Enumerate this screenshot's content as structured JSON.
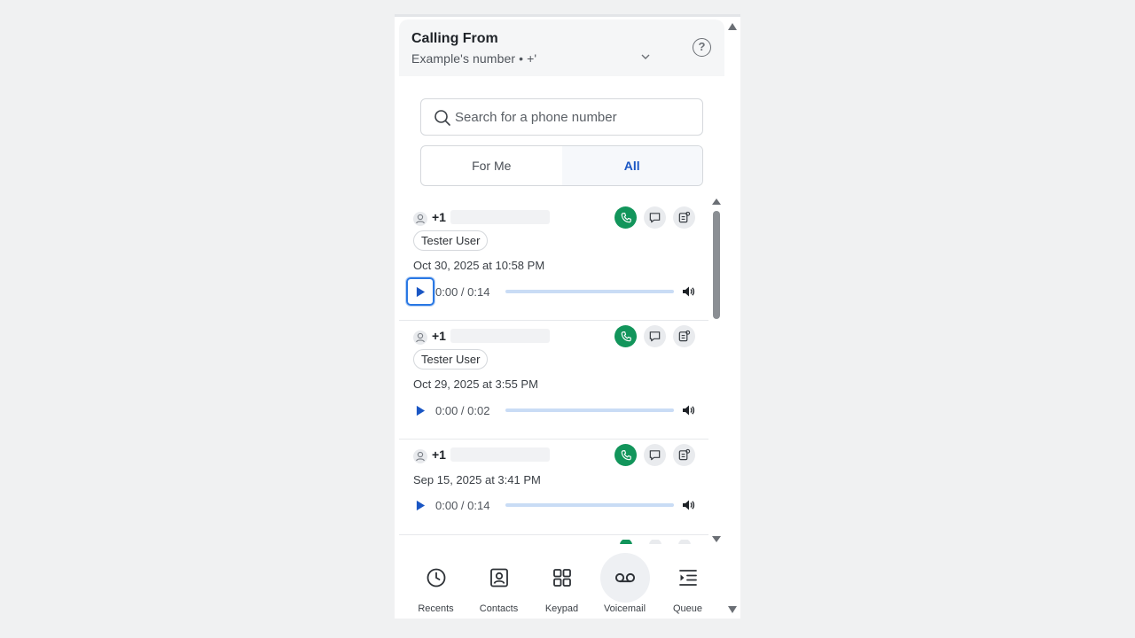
{
  "header": {
    "title": "Calling From",
    "subtitle": "Example's number • +'",
    "help_glyph": "?"
  },
  "search": {
    "placeholder": "Search for a phone number",
    "value": ""
  },
  "filter": {
    "options": [
      "For Me",
      "All"
    ],
    "selected": "All"
  },
  "voicemails": [
    {
      "phone": "+1",
      "tag": "Tester User",
      "date": "Oct 30, 2025 at 10:58 PM",
      "time": "0:00 / 0:14"
    },
    {
      "phone": "+1",
      "tag": "Tester User",
      "date": "Oct 29, 2025 at 3:55 PM",
      "time": "0:00 / 0:02"
    },
    {
      "phone": "+1",
      "tag": "",
      "date": "Sep 15, 2025 at 3:41 PM",
      "time": "0:00 / 0:14"
    }
  ],
  "nav": {
    "items": [
      {
        "label": "Recents",
        "icon": "clock-icon"
      },
      {
        "label": "Contacts",
        "icon": "contact-card-icon"
      },
      {
        "label": "Keypad",
        "icon": "grid-icon"
      },
      {
        "label": "Voicemail",
        "icon": "voicemail-icon"
      },
      {
        "label": "Queue",
        "icon": "queue-icon"
      }
    ],
    "active": "Voicemail"
  },
  "colors": {
    "accent": "#1a56c4",
    "call": "#12955b",
    "track": "#c9dcf5"
  }
}
